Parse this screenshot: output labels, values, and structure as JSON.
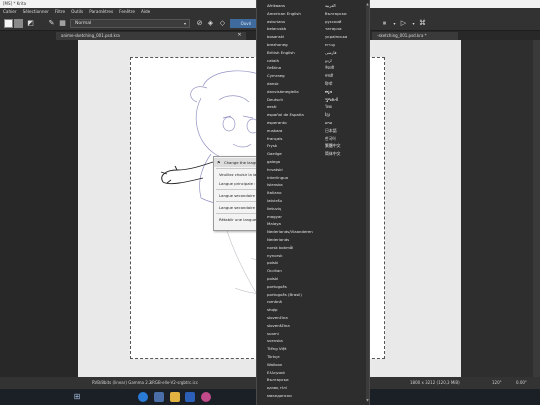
{
  "window": {
    "title": "[MS] * Krita"
  },
  "menubar": [
    "Cahier",
    "Sélectionner",
    "Filtre",
    "Outils",
    "Paramètres",
    "Fenêtre",
    "Aide"
  ],
  "toolbar": {
    "blend_mode": "Normal",
    "open_label": "Ouvri"
  },
  "tabs": {
    "left": "anime-sketching_001.psd.kra",
    "right": "-sketching_001.psd.kra *"
  },
  "context_menu": {
    "header": "Change the langu",
    "items": [
      "Veuillez choisir la langu",
      "Langue principale :",
      "Langue secondaire :",
      "Langue secondaire :",
      "Rétablir une langue à la"
    ]
  },
  "language_list": {
    "left": [
      "Afrikaans",
      "American English",
      "asturianu",
      "beIaruskà",
      "bosanski",
      "brezhoneg",
      "British English",
      "català",
      "čeština",
      "Cymraeg",
      "dansk",
      "davvisámegiella",
      "Deutsch",
      "eesti",
      "español de España",
      "esperanto",
      "euskara",
      "français",
      "Frysk",
      "Gaeilge",
      "galego",
      "hrvatski",
      "interlingua",
      "íslenska",
      "Italiano",
      "latviešu",
      "lietuvių",
      "magyar",
      "Malaya",
      "Nederlands/Vlaanderen",
      "Nederlands",
      "norsk bokmål",
      "nynorsk",
      "polski",
      "Occitan",
      "polski",
      "português",
      "português (Brasil)",
      "română",
      "shqip",
      "slovenčina",
      "slovenščina",
      "suomi",
      "svenska",
      "Tiếng Việt",
      "Türkçe",
      "Walloon",
      "Ελληνικά",
      "български",
      "қазақ тілі",
      "македонски"
    ],
    "right": [
      "العربية",
      "български",
      "русский",
      "татарча",
      "українська",
      "עברית",
      "فارسی",
      "اردو",
      "नेपाली",
      "मराठी",
      "हिन्दी",
      "ಕನ್ನಡ",
      "ગુજરાતી",
      "ไทย",
      "ខ្មែរ",
      "ລາວ",
      "日本語",
      "한국어",
      "繁體中文",
      "简体中文"
    ]
  },
  "statusbar": {
    "left": "RVB/8bits (linear) Gamma 2.2",
    "center": "sRGB-elle-V2-srgbtrc.icc",
    "size": "1800 x 3212 (120,3 MiB)",
    "zoom": "120°",
    "angle": "0.00°"
  },
  "colors": {
    "accent": "#3e6a9e",
    "menu_bg": "#323232",
    "canvas": "#ffffff"
  }
}
